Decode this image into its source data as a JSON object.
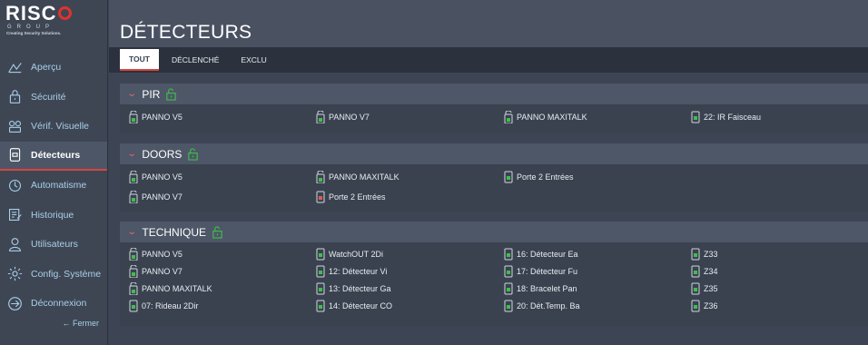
{
  "logo": {
    "brand": "RISC",
    "group": "GROUP",
    "tagline": "Creating Security Solutions."
  },
  "sidebar": {
    "items": [
      {
        "label": "Aperçu",
        "icon": "overview-icon"
      },
      {
        "label": "Sécurité",
        "icon": "security-lock-icon"
      },
      {
        "label": "Vérif. Visuelle",
        "icon": "camera-icon"
      },
      {
        "label": "Détecteurs",
        "icon": "detector-icon"
      },
      {
        "label": "Automatisme",
        "icon": "automation-icon"
      },
      {
        "label": "Historique",
        "icon": "history-icon"
      },
      {
        "label": "Utilisateurs",
        "icon": "user-icon"
      },
      {
        "label": "Config. Système",
        "icon": "gear-icon"
      },
      {
        "label": "Déconnexion",
        "icon": "logout-icon"
      }
    ],
    "close_label": "← Fermer"
  },
  "page": {
    "title": "DÉTECTEURS"
  },
  "tabs": [
    {
      "label": "TOUT"
    },
    {
      "label": "DÉCLENCHÉ"
    },
    {
      "label": "EXCLU"
    }
  ],
  "sections": [
    {
      "title": "PIR",
      "rows": [
        [
          "PANNO V5",
          "PANNO V7",
          "PANNO MAXITALK",
          "22: IR Faisceau"
        ]
      ]
    },
    {
      "title": "DOORS",
      "rows": [
        [
          "PANNO V5",
          "PANNO MAXITALK",
          "Porte 2 Entrées"
        ],
        [
          "PANNO V7",
          "Porte 2 Entrées"
        ]
      ]
    },
    {
      "title": "TECHNIQUE",
      "rows": [
        [
          "PANNO V5",
          "WatchOUT 2Di",
          "16: Détecteur Ea",
          "Z33"
        ],
        [
          "PANNO V7",
          "12: Détecteur Vi",
          "17: Détecteur Fu",
          "Z34"
        ],
        [
          "PANNO MAXITALK",
          "13: Détecteur Ga",
          "18: Bracelet Pan",
          "Z35"
        ],
        [
          "07: Rideau 2Dir",
          "14: Détecteur CO",
          "20: Dét.Temp. Ba",
          "Z36"
        ]
      ]
    }
  ],
  "colors": {
    "accent_red": "#d9443e",
    "lock_green": "#3fbf4a",
    "link_blue": "#a9cfe8",
    "alarm_red": "#e05a55"
  }
}
